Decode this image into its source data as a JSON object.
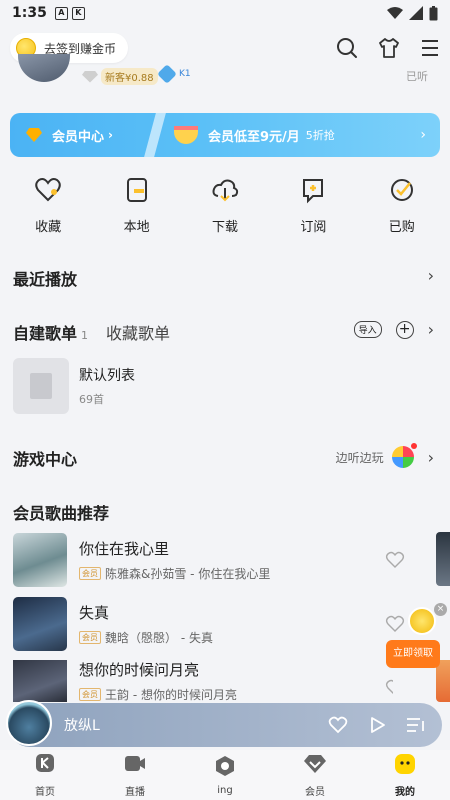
{
  "status": {
    "time": "1:35"
  },
  "topbar": {
    "signin_label": "去签到赚金币"
  },
  "profile": {
    "new_badge": "新客¥0.88",
    "level": "K1",
    "listened_label": "已听"
  },
  "vip_banner": {
    "center_label": "会员中心",
    "promo_label": "会员低至9元/月",
    "promo_sub": "5折抢"
  },
  "quick_actions": [
    {
      "label": "收藏",
      "icon": "heart-icon"
    },
    {
      "label": "本地",
      "icon": "local-file-icon"
    },
    {
      "label": "下载",
      "icon": "download-icon"
    },
    {
      "label": "订阅",
      "icon": "subscribe-icon"
    },
    {
      "label": "已购",
      "icon": "purchased-icon"
    }
  ],
  "recent": {
    "title": "最近播放"
  },
  "playlists": {
    "tab_created": "自建歌单",
    "created_count": "1",
    "tab_collected": "收藏歌单",
    "import_label": "导入",
    "default_list": {
      "name": "默认列表",
      "count": "69首"
    }
  },
  "game": {
    "title": "游戏中心",
    "hint": "边听边玩"
  },
  "vip_songs": {
    "title": "会员歌曲推荐",
    "tag": "会员",
    "items": [
      {
        "title": "你住在我心里",
        "artist": "陈雅森&孙茹雪 - 你住在我心里"
      },
      {
        "title": "失真",
        "artist": "魏晗（慇慇） - 失真"
      },
      {
        "title": "想你的时候问月亮",
        "artist": "王韵 - 想你的时候问月亮"
      }
    ]
  },
  "float": {
    "claim_label": "立即领取",
    "close_label": "×"
  },
  "player": {
    "title": "放纵L"
  },
  "tabbar": [
    {
      "label": "首页",
      "icon": "home-icon"
    },
    {
      "label": "直播",
      "icon": "live-icon"
    },
    {
      "label": "ing",
      "icon": "ing-icon"
    },
    {
      "label": "会员",
      "icon": "vip-icon"
    },
    {
      "label": "我的",
      "icon": "mine-icon"
    }
  ]
}
